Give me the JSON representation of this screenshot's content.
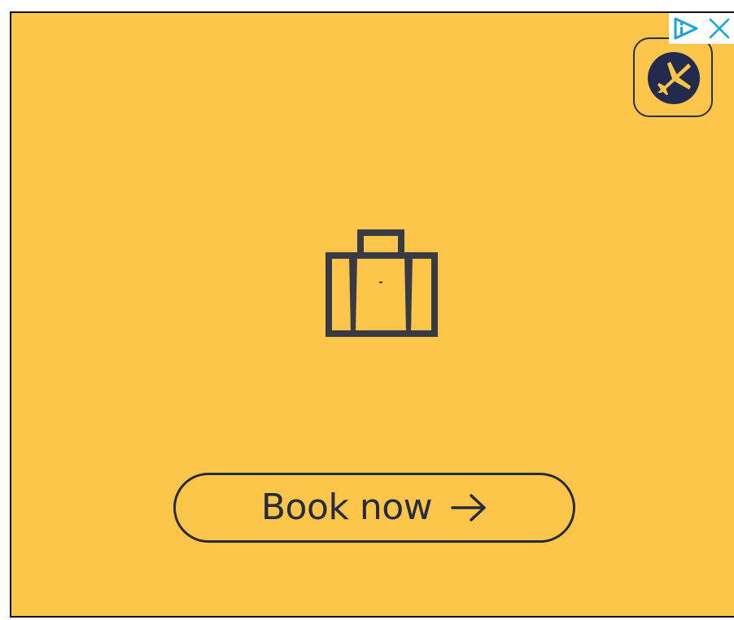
{
  "colors": {
    "background": "#fdc54a",
    "ink": "#2b3147",
    "logo_circle": "#222b4d",
    "adchoices": "#1aa3d6"
  },
  "brand": {
    "logo_icon": "plane-icon"
  },
  "hero": {
    "icon": "suitcase-icon"
  },
  "cta": {
    "label": "Book now",
    "icon": "arrow-right-icon"
  },
  "ad_controls": {
    "adchoices_icon": "adchoices-icon",
    "close_icon": "close-icon"
  }
}
